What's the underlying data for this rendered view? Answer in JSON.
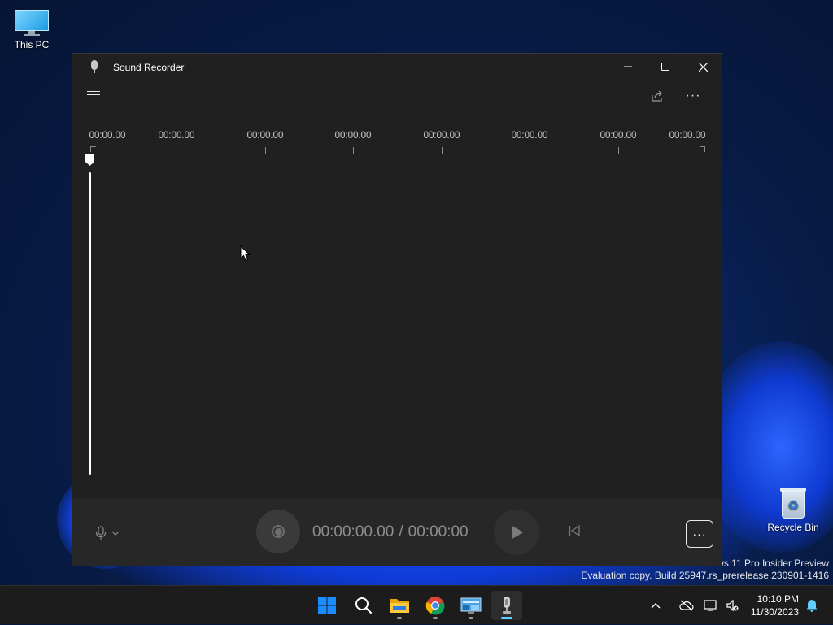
{
  "desktop": {
    "icons": [
      {
        "label": "This PC"
      },
      {
        "label": "Recycle Bin"
      }
    ],
    "watermark": {
      "line1": "ws 11 Pro Insider Preview",
      "line2": "Evaluation copy. Build 25947.rs_prerelease.230901-1416"
    }
  },
  "window": {
    "title": "Sound Recorder",
    "icon": "microphone-icon",
    "controls": [
      "minimize-icon",
      "maximize-icon",
      "close-icon"
    ],
    "toolbar": {
      "menu_icon": "hamburger-icon",
      "share_icon": "share-icon",
      "more_label": "···"
    },
    "timeline": {
      "ticks": [
        "00:00.00",
        "00:00.00",
        "00:00.00",
        "00:00.00",
        "00:00.00",
        "00:00.00",
        "00:00.00",
        "00:00.00"
      ]
    },
    "controls_bar": {
      "mic_icon": "microphone-icon",
      "current_time": "00:00:00.00",
      "separator": "/",
      "total_time": "00:00:00",
      "options_label": "···"
    }
  },
  "taskbar": {
    "apps": [
      "start-icon",
      "search-icon",
      "file-explorer-icon",
      "chrome-icon",
      "control-panel-icon",
      "sound-recorder-icon"
    ],
    "clock": {
      "time": "10:10 PM",
      "date": "11/30/2023"
    }
  },
  "colors": {
    "accent": "#60cdff",
    "window_bg": "#202020",
    "bar_bg": "#272727"
  }
}
